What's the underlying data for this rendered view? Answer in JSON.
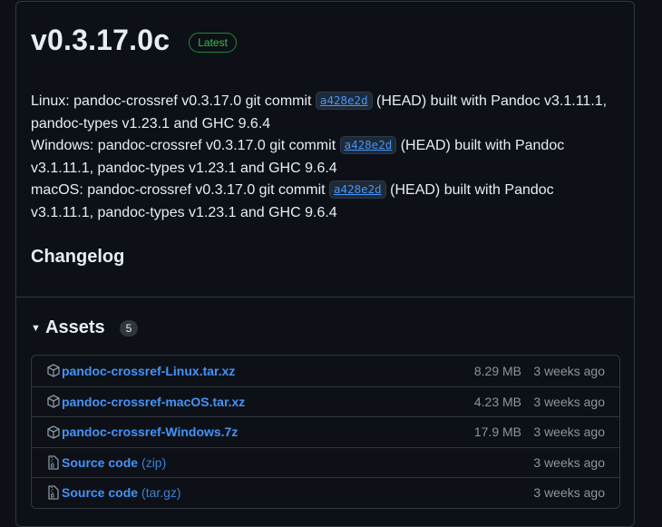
{
  "release": {
    "title": "v0.3.17.0c",
    "badge": "Latest"
  },
  "notes": [
    {
      "before": "Linux: pandoc-crossref v0.3.17.0 git commit ",
      "commit": "a428e2d",
      "after": " (HEAD) built with Pandoc v3.1.11.1, pandoc-types v1.23.1 and GHC 9.6.4"
    },
    {
      "before": "Windows: pandoc-crossref v0.3.17.0 git commit ",
      "commit": "a428e2d",
      "after": " (HEAD) built with Pandoc v3.1.11.1, pandoc-types v1.23.1 and GHC 9.6.4"
    },
    {
      "before": "macOS: pandoc-crossref v0.3.17.0 git commit ",
      "commit": "a428e2d",
      "after": " (HEAD) built with Pandoc v3.1.11.1, pandoc-types v1.23.1 and GHC 9.6.4"
    }
  ],
  "changelog_heading": "Changelog",
  "assets": {
    "heading": "Assets",
    "count": "5",
    "items": [
      {
        "icon": "package-icon",
        "name": "pandoc-crossref-Linux.tar.xz",
        "suffix": "",
        "size": "8.29 MB",
        "date": "3 weeks ago"
      },
      {
        "icon": "package-icon",
        "name": "pandoc-crossref-macOS.tar.xz",
        "suffix": "",
        "size": "4.23 MB",
        "date": "3 weeks ago"
      },
      {
        "icon": "package-icon",
        "name": "pandoc-crossref-Windows.7z",
        "suffix": "",
        "size": "17.9 MB",
        "date": "3 weeks ago"
      },
      {
        "icon": "file-zip-icon",
        "name": "Source code",
        "suffix": "(zip)",
        "size": "",
        "date": "3 weeks ago"
      },
      {
        "icon": "file-zip-icon",
        "name": "Source code",
        "suffix": "(tar.gz)",
        "size": "",
        "date": "3 weeks ago"
      }
    ]
  }
}
